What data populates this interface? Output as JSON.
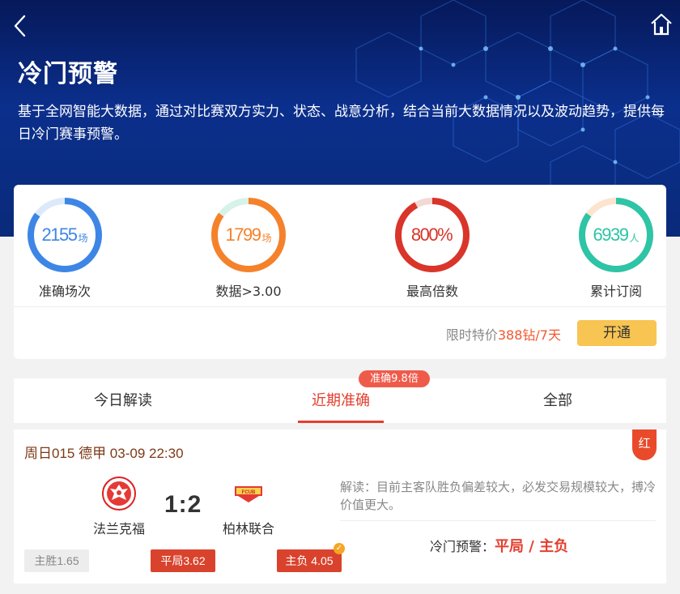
{
  "header": {
    "title": "冷门预警",
    "description": "基于全网智能大数据，通过对比赛双方实力、状态、战意分析，结合当前大数据情况以及波动趋势，提供每日冷门赛事预警。",
    "back_icon": "chevron-left-icon",
    "home_icon": "home-icon"
  },
  "stats": [
    {
      "value": "2155",
      "unit": "场",
      "label": "准确场次",
      "color": "#3d86e6",
      "track": "#dce9fb",
      "progress": 0.85
    },
    {
      "value": "1799",
      "unit": "场",
      "label": "数据>3.00",
      "color": "#f5822b",
      "track": "#d7f2e8",
      "progress": 0.85
    },
    {
      "value": "800%",
      "unit": "",
      "label": "最高倍数",
      "color": "#d9352a",
      "track": "#f3d8d4",
      "progress": 0.92
    },
    {
      "value": "6939",
      "unit": "人",
      "label": "累计订阅",
      "color": "#2ec4a6",
      "track": "#fde4cf",
      "progress": 0.85
    }
  ],
  "price": {
    "prefix": "限时特价",
    "amount": "388钻/7天",
    "button": "开通"
  },
  "tabs": [
    {
      "label": "今日解读",
      "active": false
    },
    {
      "label": "近期准确",
      "active": true
    },
    {
      "label": "全部",
      "active": false
    }
  ],
  "tab_badge": "准确9.8倍",
  "match": {
    "header": "周日015 德甲 03-09 22:30",
    "tag": "红",
    "home": "法兰克福",
    "away": "柏林联合",
    "score": "1:2",
    "analysis": "解读：目前主客队胜负偏差较大，必发交易规模较大，搏冷价值更大。",
    "verdict_label": "冷门预警：",
    "verdict_value": "平局 / 主负",
    "odds": [
      {
        "label": "主胜1.65",
        "selected": false
      },
      {
        "label": "平局3.62",
        "selected": true
      },
      {
        "label": "主负 4.05",
        "selected": true
      }
    ]
  }
}
